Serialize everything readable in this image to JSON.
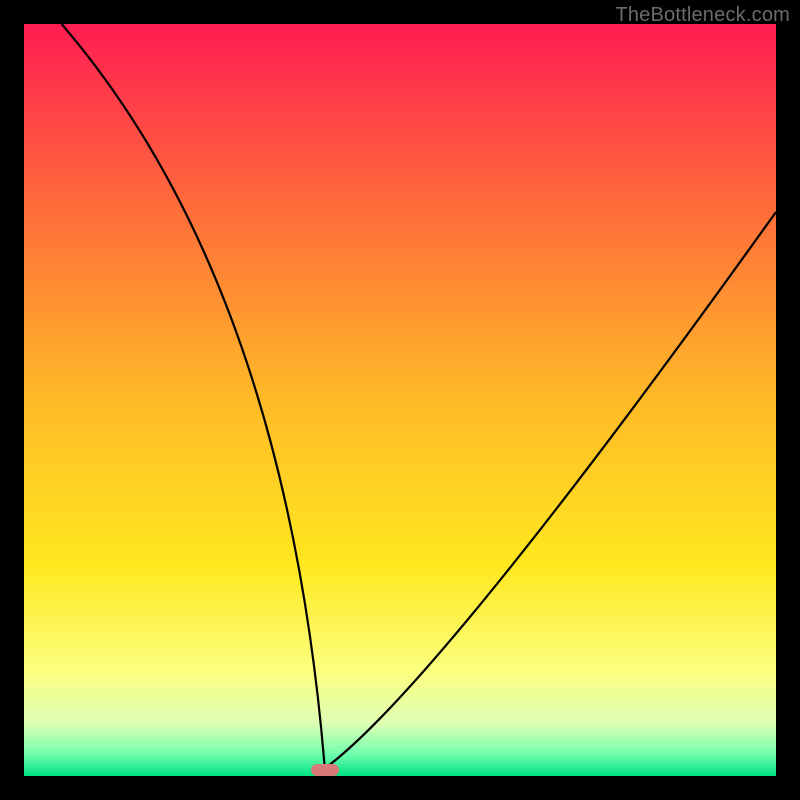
{
  "watermark": "TheBottleneck.com",
  "chart_data": {
    "type": "line",
    "title": "",
    "xlabel": "",
    "ylabel": "",
    "xlim": [
      0,
      100
    ],
    "ylim": [
      0,
      100
    ],
    "grid": false,
    "legend": false,
    "gradient_stops": [
      {
        "offset": 0.0,
        "color": "#ff1d52"
      },
      {
        "offset": 0.25,
        "color": "#ff6e3a"
      },
      {
        "offset": 0.5,
        "color": "#ffba27"
      },
      {
        "offset": 0.72,
        "color": "#ffe81f"
      },
      {
        "offset": 0.86,
        "color": "#fbff7e"
      },
      {
        "offset": 0.93,
        "color": "#dfffb5"
      },
      {
        "offset": 0.97,
        "color": "#74ffad"
      },
      {
        "offset": 1.0,
        "color": "#00e184"
      }
    ],
    "notch_x": 40,
    "left_branch": {
      "x_start": 5,
      "y_start": 100,
      "x_end": 40,
      "y_end": 1,
      "curvature": 0.85
    },
    "right_branch": {
      "x_start": 40,
      "y_start": 1,
      "x_end": 100,
      "y_end": 75,
      "curvature": 0.75
    },
    "marker": {
      "x": 40,
      "y": 0.8,
      "color": "#d87a78"
    }
  }
}
